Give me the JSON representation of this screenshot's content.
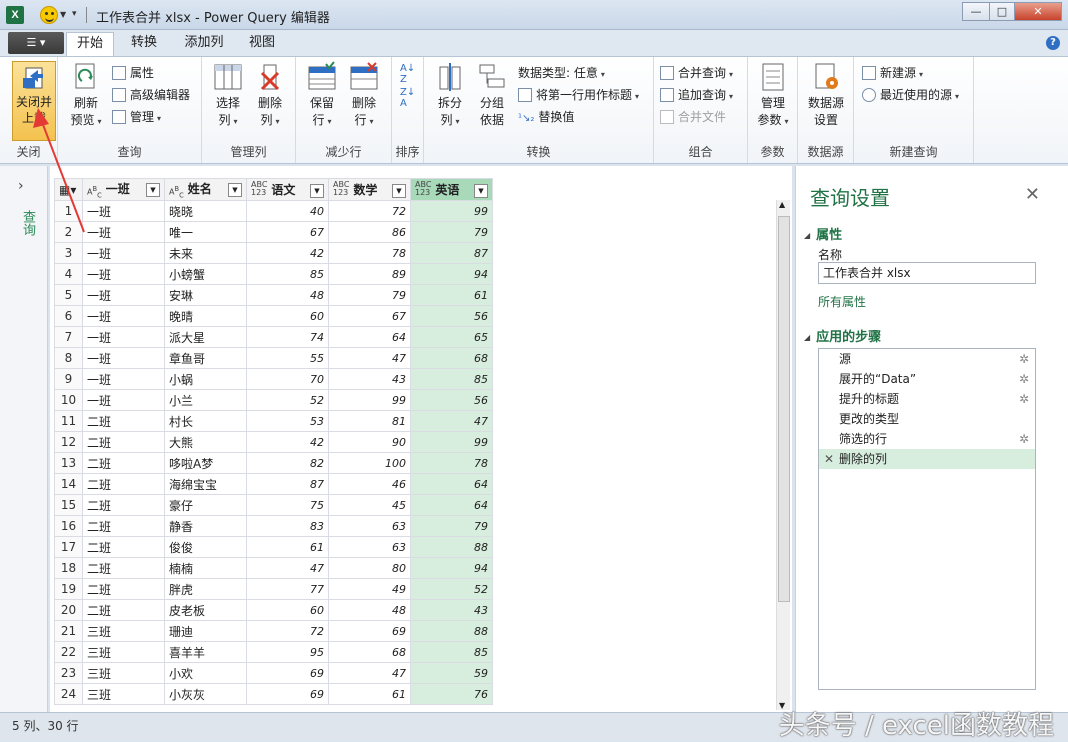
{
  "window": {
    "title": "工作表合并 xlsx - Power Query 编辑器",
    "controls": [
      "—",
      "□",
      "✕"
    ]
  },
  "tabs": [
    "开始",
    "转换",
    "添加列",
    "视图"
  ],
  "active_tab": "开始",
  "ribbon": {
    "close": {
      "btn": "关闭并上载",
      "line1": "关闭并",
      "line2": "上载",
      "group": "关闭"
    },
    "query": {
      "refresh_1": "刷新",
      "refresh_2": "预览",
      "properties": "属性",
      "advanced_editor": "高级编辑器",
      "manage": "管理",
      "group": "查询"
    },
    "manage_cols": {
      "choose_1": "选择",
      "choose_2": "列",
      "remove_1": "删除",
      "remove_2": "列",
      "group": "管理列"
    },
    "reduce_rows": {
      "keep_1": "保留",
      "keep_2": "行",
      "remove_1": "删除",
      "remove_2": "行",
      "group": "减少行"
    },
    "sort": {
      "group": "排序"
    },
    "transform": {
      "split_1": "拆分",
      "split_2": "列",
      "groupby_1": "分组",
      "groupby_2": "依据",
      "datatype": "数据类型: 任意",
      "first_row_header": "将第一行用作标题",
      "replace": "替换值",
      "group": "转换"
    },
    "combine": {
      "merge": "合并查询",
      "append": "追加查询",
      "combine_files": "合并文件",
      "group": "组合"
    },
    "params": {
      "manage_1": "管理",
      "manage_2": "参数",
      "group": "参数"
    },
    "datasource": {
      "settings_1": "数据源",
      "settings_2": "设置",
      "group": "数据源"
    },
    "newquery": {
      "new_source": "新建源",
      "recent_sources": "最近使用的源",
      "group": "新建查询"
    }
  },
  "left_rail": {
    "label": "查询"
  },
  "grid": {
    "columns": [
      {
        "type": "ABC",
        "name": "一班"
      },
      {
        "type": "ABC",
        "name": "姓名"
      },
      {
        "type": "ABC 123",
        "name": "语文"
      },
      {
        "type": "ABC 123",
        "name": "数学"
      },
      {
        "type": "ABC 123",
        "name": "英语"
      }
    ],
    "rows": [
      [
        "1",
        "一班",
        "晓晓",
        "40",
        "72",
        "99"
      ],
      [
        "2",
        "一班",
        "唯一",
        "67",
        "86",
        "79"
      ],
      [
        "3",
        "一班",
        "未来",
        "42",
        "78",
        "87"
      ],
      [
        "4",
        "一班",
        "小螃蟹",
        "85",
        "89",
        "94"
      ],
      [
        "5",
        "一班",
        "安琳",
        "48",
        "79",
        "61"
      ],
      [
        "6",
        "一班",
        "晚晴",
        "60",
        "67",
        "56"
      ],
      [
        "7",
        "一班",
        "派大星",
        "74",
        "64",
        "65"
      ],
      [
        "8",
        "一班",
        "章鱼哥",
        "55",
        "47",
        "68"
      ],
      [
        "9",
        "一班",
        "小蜗",
        "70",
        "43",
        "85"
      ],
      [
        "10",
        "一班",
        "小兰",
        "52",
        "99",
        "56"
      ],
      [
        "11",
        "二班",
        "村长",
        "53",
        "81",
        "47"
      ],
      [
        "12",
        "二班",
        "大熊",
        "42",
        "90",
        "99"
      ],
      [
        "13",
        "二班",
        "哆啦A梦",
        "82",
        "100",
        "78"
      ],
      [
        "14",
        "二班",
        "海绵宝宝",
        "87",
        "46",
        "64"
      ],
      [
        "15",
        "二班",
        "豪仔",
        "75",
        "45",
        "64"
      ],
      [
        "16",
        "二班",
        "静香",
        "83",
        "63",
        "79"
      ],
      [
        "17",
        "二班",
        "俊俊",
        "61",
        "63",
        "88"
      ],
      [
        "18",
        "二班",
        "楠楠",
        "47",
        "80",
        "94"
      ],
      [
        "19",
        "二班",
        "胖虎",
        "77",
        "49",
        "52"
      ],
      [
        "20",
        "二班",
        "皮老板",
        "60",
        "48",
        "43"
      ],
      [
        "21",
        "三班",
        "珊迪",
        "72",
        "69",
        "88"
      ],
      [
        "22",
        "三班",
        "喜羊羊",
        "95",
        "68",
        "85"
      ],
      [
        "23",
        "三班",
        "小欢",
        "69",
        "47",
        "59"
      ],
      [
        "24",
        "三班",
        "小灰灰",
        "69",
        "61",
        "76"
      ]
    ]
  },
  "query_settings": {
    "title": "查询设置",
    "properties_header": "属性",
    "name_label": "名称",
    "name_value": "工作表合并 xlsx",
    "all_properties": "所有属性",
    "steps_header": "应用的步骤",
    "steps": [
      {
        "label": "源",
        "gear": true
      },
      {
        "label": "展开的“Data”",
        "gear": true
      },
      {
        "label": "提升的标题",
        "gear": true
      },
      {
        "label": "更改的类型",
        "gear": false
      },
      {
        "label": "筛选的行",
        "gear": true
      },
      {
        "label": "删除的列",
        "gear": false
      }
    ]
  },
  "status": {
    "text": "5 列、30 行"
  },
  "watermark": "头条号 / excel函数教程",
  "colors": {
    "accent": "#217346",
    "selected_col": "#d7eedf",
    "arrow": "#e53935"
  }
}
